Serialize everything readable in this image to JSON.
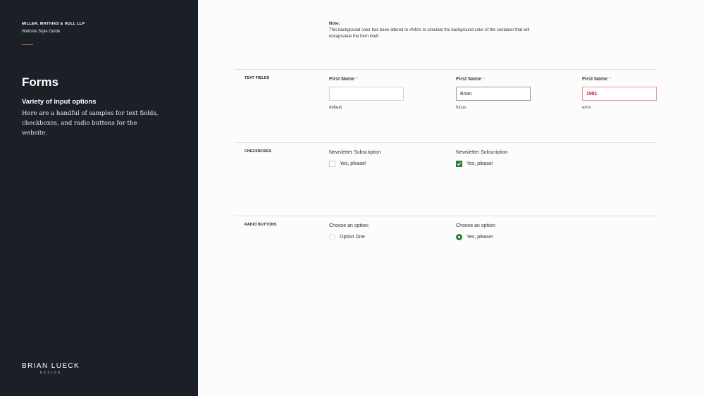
{
  "colors": {
    "sidebar_bg": "#1b1f26",
    "accent": "#e06a55",
    "required": "#e08a4a",
    "error_border": "#e39a9a",
    "error_text": "#b0202a",
    "check_green": "#2e7d32",
    "page_bg": "#fcfcfc"
  },
  "sidebar": {
    "company": "MILLER, MATHIAS & HULL LLP",
    "subtitle": "Website Style Guide",
    "title": "Forms",
    "section_heading": "Variety of input options",
    "description": "Here are a handful of samples for text fields, checkboxes, and radio buttons for the website.",
    "brand_name": "BRIAN LUECK",
    "brand_sub": "DESIGN"
  },
  "note": {
    "label": "Note:",
    "text": "This background color has been altered to #fcfcfc to simulate the background color of the container that will encapsulate the form itself."
  },
  "text_fields": {
    "section_label": "TEXT FIELDS",
    "required_mark": "*",
    "samples": [
      {
        "label": "First Name",
        "value": "",
        "caption": "default"
      },
      {
        "label": "First Name",
        "value": "Brian",
        "caption": "focus"
      },
      {
        "label": "First Name",
        "value": "1981",
        "caption": "error"
      }
    ]
  },
  "checkboxes": {
    "section_label": "CHECKBOXES",
    "samples": [
      {
        "group_label": "Newsletter Subscription",
        "option": "Yes, please!",
        "checked": false
      },
      {
        "group_label": "Newsletter Subscription",
        "option": "Yes, please!",
        "checked": true
      }
    ]
  },
  "radio_buttons": {
    "section_label": "RADIO BUTTONS",
    "samples": [
      {
        "group_label": "Choose an option:",
        "option": "Option One",
        "selected": false
      },
      {
        "group_label": "Choose an option:",
        "option": "Yes, please!",
        "selected": true
      }
    ]
  }
}
